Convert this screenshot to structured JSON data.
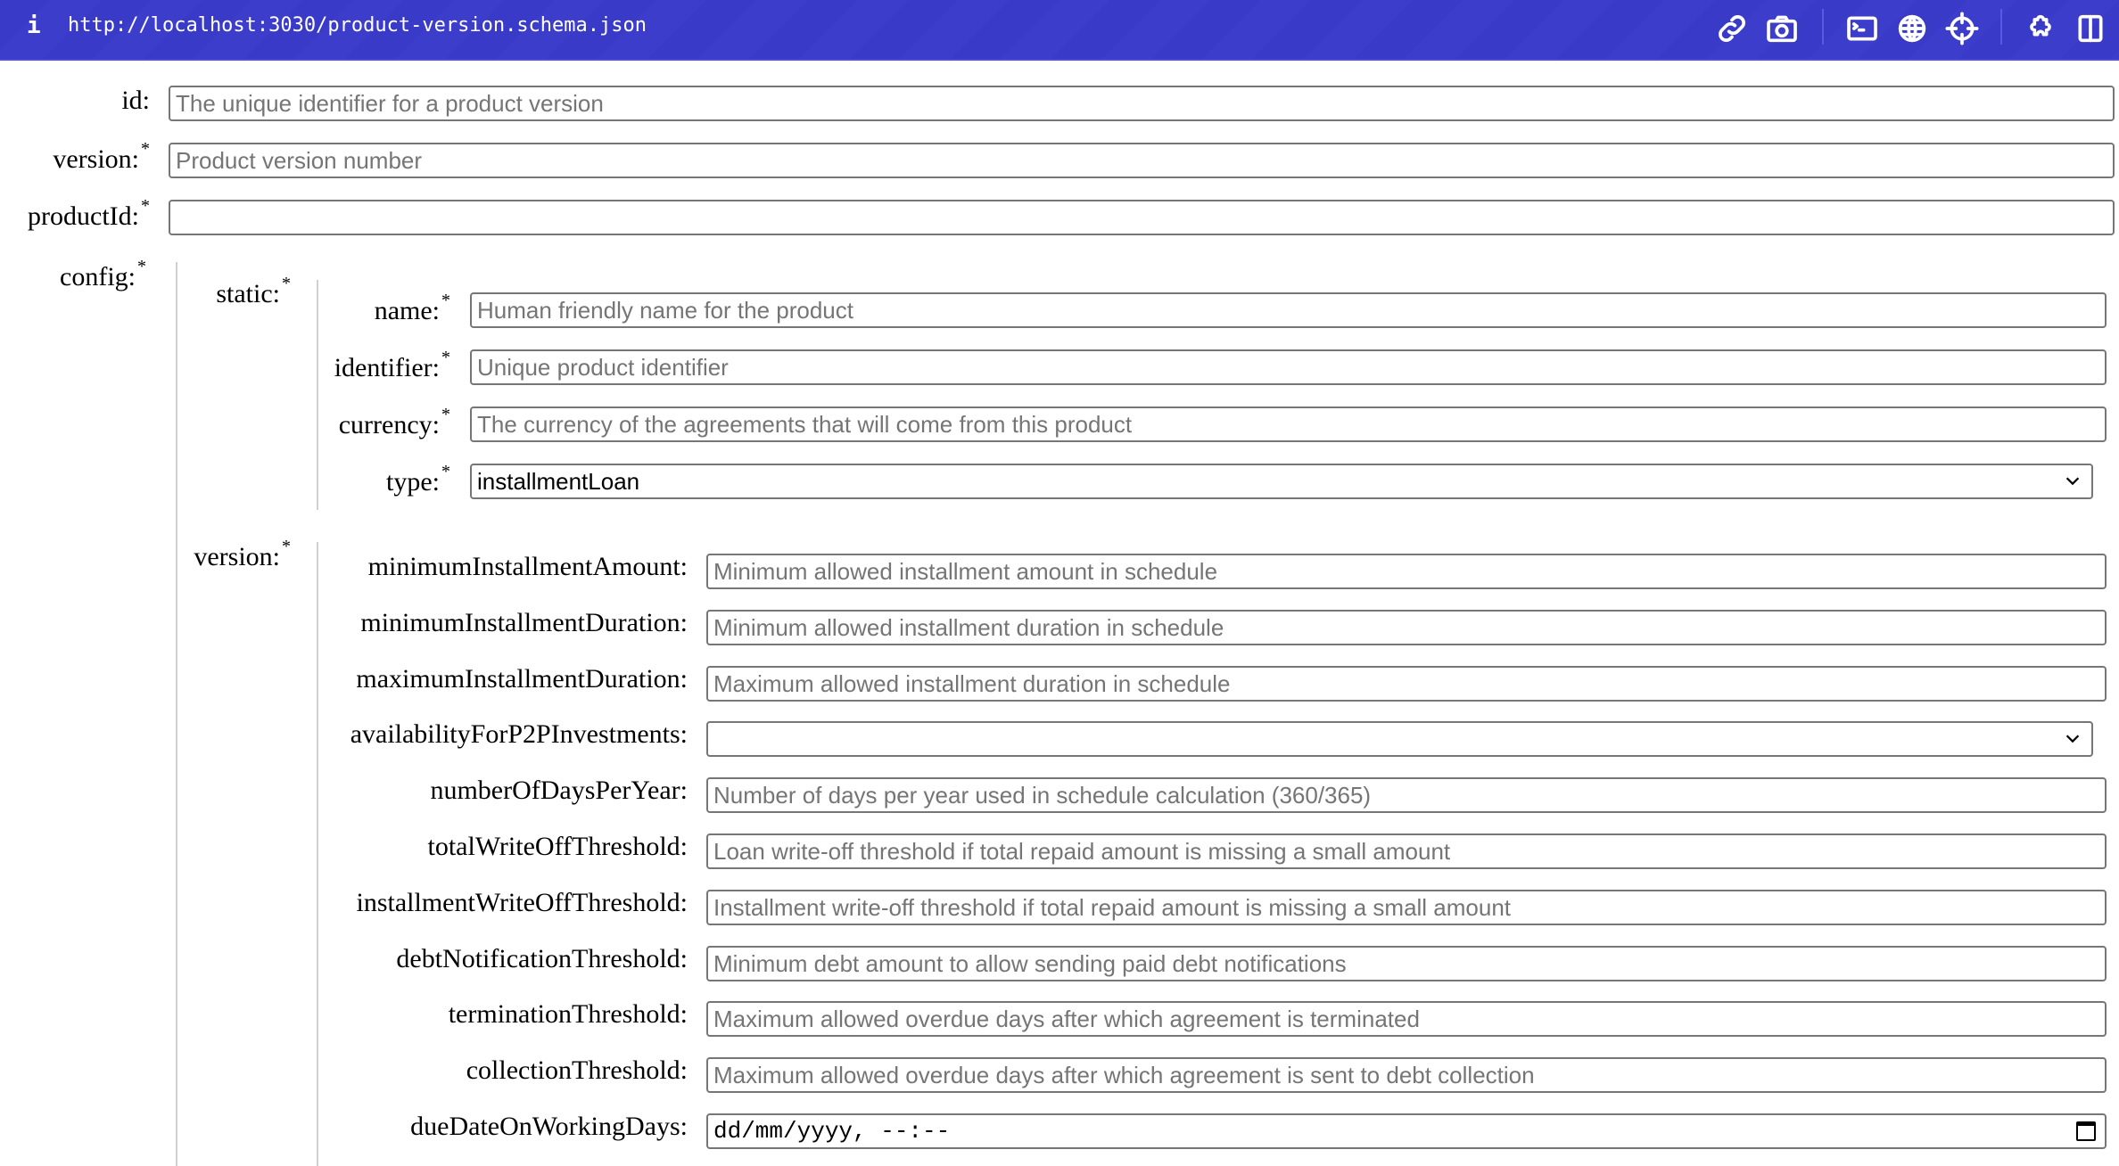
{
  "toolbar": {
    "url": "http://localhost:3030/product-version.schema.json",
    "icons": [
      "info-icon",
      "link-icon",
      "camera-icon",
      "terminal-icon",
      "globe-icon",
      "crosshair-icon",
      "puzzle-icon",
      "split-view-icon"
    ]
  },
  "top_fields": [
    {
      "label": "id:",
      "required": false,
      "placeholder": "The unique identifier for a product version"
    },
    {
      "label": "version:",
      "required": true,
      "placeholder": "Product version number"
    },
    {
      "label": "productId:",
      "required": true,
      "placeholder": ""
    }
  ],
  "config": {
    "label": "config:",
    "static": {
      "label": "static:",
      "fields": [
        {
          "label": "name:",
          "required": true,
          "type": "text",
          "placeholder": "Human friendly name for the product"
        },
        {
          "label": "identifier:",
          "required": true,
          "type": "text",
          "placeholder": "Unique product identifier"
        },
        {
          "label": "currency:",
          "required": true,
          "type": "text",
          "placeholder": "The currency of the agreements that will come from this product"
        },
        {
          "label": "type:",
          "required": true,
          "type": "select",
          "value": "installmentLoan"
        }
      ]
    },
    "version": {
      "label": "version:",
      "fields": [
        {
          "label": "minimumInstallmentAmount:",
          "type": "text",
          "placeholder": "Minimum allowed installment amount in schedule"
        },
        {
          "label": "minimumInstallmentDuration:",
          "type": "text",
          "placeholder": "Minimum allowed installment duration in schedule"
        },
        {
          "label": "maximumInstallmentDuration:",
          "type": "text",
          "placeholder": "Maximum allowed installment duration in schedule"
        },
        {
          "label": "availabilityForP2PInvestments:",
          "type": "select",
          "value": ""
        },
        {
          "label": "numberOfDaysPerYear:",
          "type": "text",
          "placeholder": "Number of days per year used in schedule calculation (360/365)"
        },
        {
          "label": "totalWriteOffThreshold:",
          "type": "text",
          "placeholder": "Loan write-off threshold if total repaid amount is missing a small amount"
        },
        {
          "label": "installmentWriteOffThreshold:",
          "type": "text",
          "placeholder": "Installment write-off threshold if total repaid amount is missing a small amount"
        },
        {
          "label": "debtNotificationThreshold:",
          "type": "text",
          "placeholder": "Minimum debt amount to allow sending paid debt notifications"
        },
        {
          "label": "terminationThreshold:",
          "type": "text",
          "placeholder": "Maximum allowed overdue days after which agreement is terminated"
        },
        {
          "label": "collectionThreshold:",
          "type": "text",
          "placeholder": "Maximum allowed overdue days after which agreement is sent to debt collection"
        },
        {
          "label": "dueDateOnWorkingDays:",
          "type": "datetime",
          "placeholder": "dd/mm/yyyy, --:--"
        }
      ]
    }
  },
  "required_mark": "*"
}
